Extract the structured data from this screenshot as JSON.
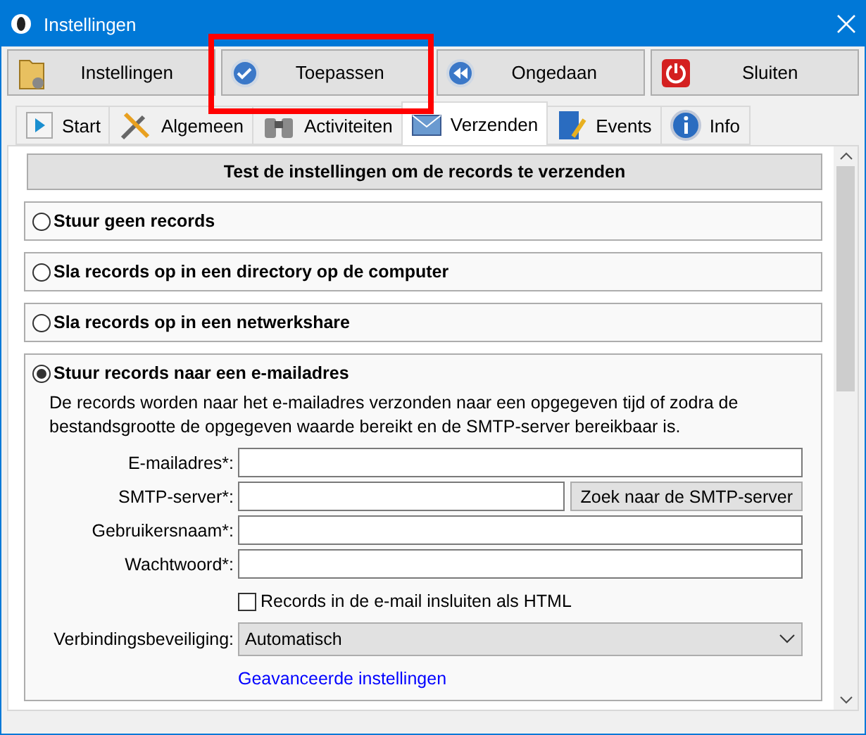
{
  "window": {
    "title": "Instellingen"
  },
  "toolbar": [
    {
      "label": "Instellingen",
      "highlighted": false
    },
    {
      "label": "Toepassen",
      "highlighted": true
    },
    {
      "label": "Ongedaan",
      "highlighted": false
    },
    {
      "label": "Sluiten",
      "highlighted": false
    }
  ],
  "tabs": [
    {
      "label": "Start",
      "selected": false
    },
    {
      "label": "Algemeen",
      "selected": false
    },
    {
      "label": "Activiteiten",
      "selected": false
    },
    {
      "label": "Verzenden",
      "selected": true
    },
    {
      "label": "Events",
      "selected": false
    },
    {
      "label": "Info",
      "selected": false
    }
  ],
  "test_button": "Test de instellingen om de records te verzenden",
  "options": [
    {
      "label": "Stuur geen records",
      "selected": false
    },
    {
      "label": "Sla records op in een directory op de computer",
      "selected": false
    },
    {
      "label": "Sla records op in een netwerkshare",
      "selected": false
    },
    {
      "label": "Stuur records naar een e-mailadres",
      "selected": true
    }
  ],
  "email": {
    "description": "De records worden naar het e-mailadres verzonden naar een opgegeven tijd of zodra de bestandsgrootte de opgegeven waarde bereikt en de SMTP-server bereikbaar is.",
    "fields": [
      {
        "label": "E-mailadres*:"
      },
      {
        "label": "SMTP-server*:",
        "button": "Zoek naar de SMTP-server"
      },
      {
        "label": "Gebruikersnaam*:"
      },
      {
        "label": "Wachtwoord*:"
      }
    ],
    "checkbox": {
      "label": "Records in de e-mail insluiten als HTML",
      "checked": false
    },
    "security": {
      "label": "Verbindingsbeveiliging:",
      "value": "Automatisch"
    },
    "link": "Geavanceerde instellingen"
  }
}
